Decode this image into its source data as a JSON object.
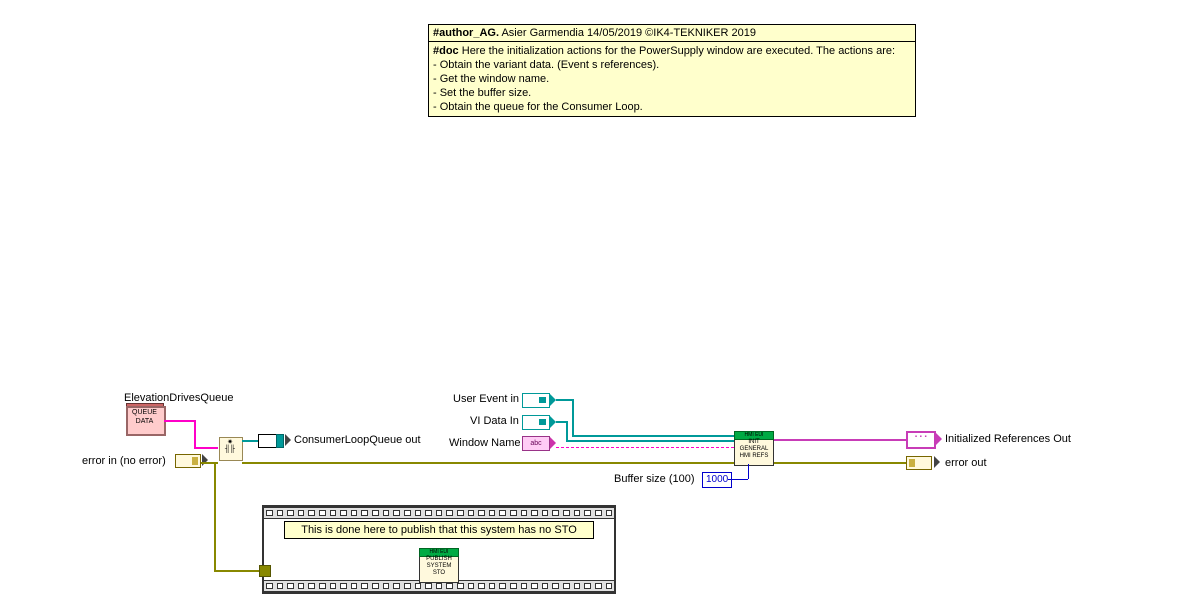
{
  "author_tag": "#author_AG.",
  "author_text": " Asier Garmendia 14/05/2019 ©IK4-TEKNIKER 2019",
  "doc_tag": "#doc",
  "doc_text": " Here the initialization actions for the PowerSupply window are executed. The actions are:",
  "doc_lines": [
    " - Obtain the variant data. (Event s references).",
    " - Get the window name.",
    " - Set the buffer size.",
    " - Obtain the  queue  for the Consumer Loop."
  ],
  "labels": {
    "elevation_drives_queue": "ElevationDrivesQueue",
    "queue_data_top": "QUEUE",
    "queue_data_bot": "DATA",
    "consumer_loop_queue_out": "ConsumerLoopQueue out",
    "error_in": "error in (no error)",
    "user_event_in": "User Event in",
    "vi_data_in": "VI Data In",
    "window_name": "Window Name",
    "buffer_size": "Buffer size (100)",
    "initialized_refs_out": "Initialized References Out",
    "error_out": "error out"
  },
  "constants": {
    "buffer_size_value": "1000",
    "string_terminal_glyph": "abc"
  },
  "subvi_init": {
    "header": "HMI EUI",
    "line1": "INIT",
    "line2": "GENERAL",
    "line3": "HMI REFS"
  },
  "subvi_sto": {
    "header": "HMI EUI",
    "line1": "PUBLISH",
    "line2": "SYSTEM",
    "line3": "STO"
  },
  "sto_note": "This is done here to publish that this system has no STO"
}
